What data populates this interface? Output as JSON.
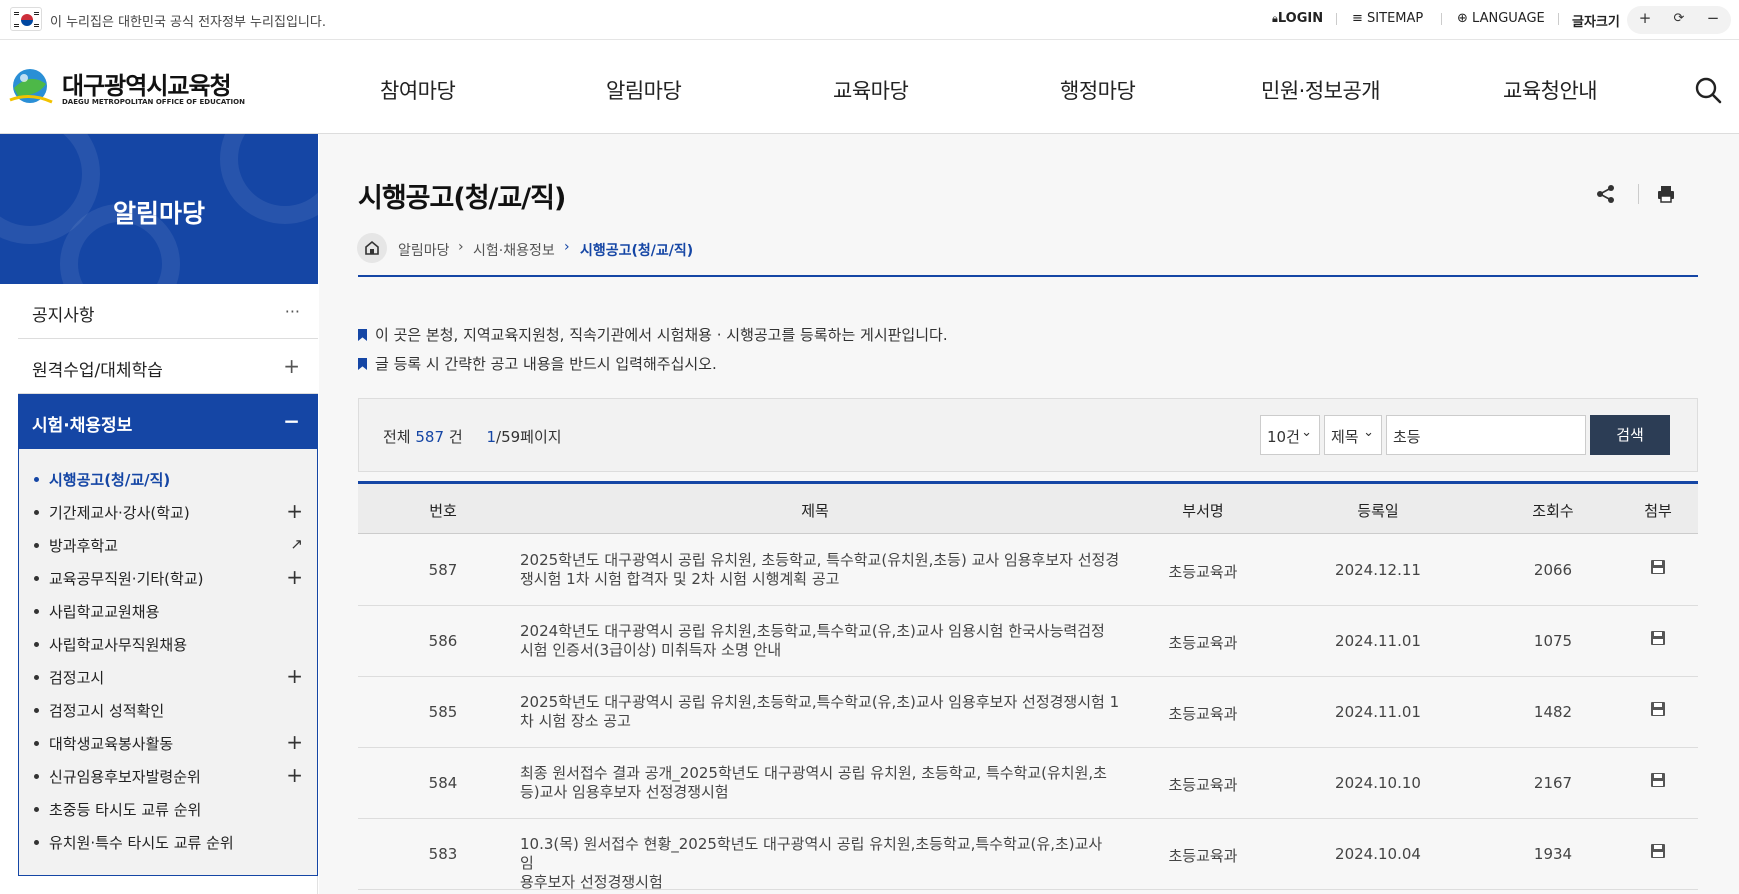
{
  "gov_banner": {
    "text": "이 누리집은 대한민국 공식 전자정부 누리집입니다."
  },
  "utility": {
    "login": "LOGIN",
    "sitemap": "SITEMAP",
    "language": "LANGUAGE",
    "font_size_label": "글자크기",
    "font_plus": "+",
    "font_reset": "⟳",
    "font_minus": "−"
  },
  "logo": {
    "title": "대구광역시교육청",
    "subtitle": "DAEGU METROPOLITAN OFFICE OF EDUCATION"
  },
  "gnb": [
    "참여마당",
    "알림마당",
    "교육마당",
    "행정마당",
    "민원·정보공개",
    "교육청안내"
  ],
  "sidebar": {
    "hero_title": "알림마당",
    "depth1": [
      {
        "label": "공지사항",
        "icon": "···"
      },
      {
        "label": "원격수업/대체학습",
        "icon": "+"
      },
      {
        "label": "시험·채용정보",
        "icon": "−"
      }
    ],
    "depth2": [
      {
        "label": "시행공고(청/교/직)",
        "icon": ""
      },
      {
        "label": "기간제교사·강사(학교)",
        "icon": "+"
      },
      {
        "label": "방과후학교",
        "icon": "↗"
      },
      {
        "label": "교육공무직원·기타(학교)",
        "icon": "+"
      },
      {
        "label": "사립학교교원채용",
        "icon": ""
      },
      {
        "label": "사립학교사무직원채용",
        "icon": ""
      },
      {
        "label": "검정고시",
        "icon": "+"
      },
      {
        "label": "검정고시 성적확인",
        "icon": ""
      },
      {
        "label": "대학생교육봉사활동",
        "icon": "+"
      },
      {
        "label": "신규임용후보자발령순위",
        "icon": "+"
      },
      {
        "label": "초중등 타시도 교류 순위",
        "icon": ""
      },
      {
        "label": "유치원·특수 타시도 교류 순위",
        "icon": ""
      }
    ]
  },
  "page": {
    "title": "시행공고(청/교/직)",
    "breadcrumb": [
      "알림마당",
      "시험·채용정보",
      "시행공고(청/교/직)"
    ],
    "notices": [
      "이 곳은 본청, 지역교육지원청, 직속기관에서 시험채용 · 시행공고를 등록하는 게시판입니다.",
      "글 등록 시 간략한 공고 내용을 반드시 입력해주십시오."
    ]
  },
  "search": {
    "total_prefix": "전체",
    "total": "587",
    "total_suffix": "건",
    "page_current": "1",
    "page_rest": "/59페이지",
    "per_page": "10건",
    "field": "제목",
    "keyword": "초등",
    "button": "검색"
  },
  "table": {
    "headers": [
      "번호",
      "제목",
      "부서명",
      "등록일",
      "조회수",
      "첨부"
    ],
    "rows": [
      {
        "no": "587",
        "title_1": "2025학년도 대구광역시 공립 유치원, 초등학교, 특수학교(유치원,초등) 교사 임용후보자 선정경",
        "title_2": "쟁시험 1차 시험 합격자 및 2차 시험 시행계획 공고",
        "dept": "초등교육과",
        "date": "2024.12.11",
        "views": "2066"
      },
      {
        "no": "586",
        "title_1": "2024학년도 대구광역시 공립 유치원,초등학교,특수학교(유,초)교사 임용시험 한국사능력검정",
        "title_2": "시험 인증서(3급이상) 미취득자 소명 안내",
        "dept": "초등교육과",
        "date": "2024.11.01",
        "views": "1075"
      },
      {
        "no": "585",
        "title_1": "2025학년도 대구광역시 공립 유치원,초등학교,특수학교(유,초)교사 임용후보자 선정경쟁시험 1",
        "title_2": "차 시험 장소 공고",
        "dept": "초등교육과",
        "date": "2024.11.01",
        "views": "1482"
      },
      {
        "no": "584",
        "title_1": "최종 원서접수 결과 공개_2025학년도 대구광역시 공립 유치원, 초등학교, 특수학교(유치원,초",
        "title_2": "등)교사 임용후보자 선정경쟁시험",
        "dept": "초등교육과",
        "date": "2024.10.10",
        "views": "2167"
      },
      {
        "no": "583",
        "title_1": "10.3(목) 원서접수 현황_2025학년도 대구광역시 공립 유치원,초등학교,특수학교(유,초)교사 임",
        "title_2": "용후보자 선정경쟁시험",
        "dept": "초등교육과",
        "date": "2024.10.04",
        "views": "1934"
      }
    ]
  },
  "colors": {
    "primary": "#1546a5",
    "button_dark": "#2c3d55"
  }
}
